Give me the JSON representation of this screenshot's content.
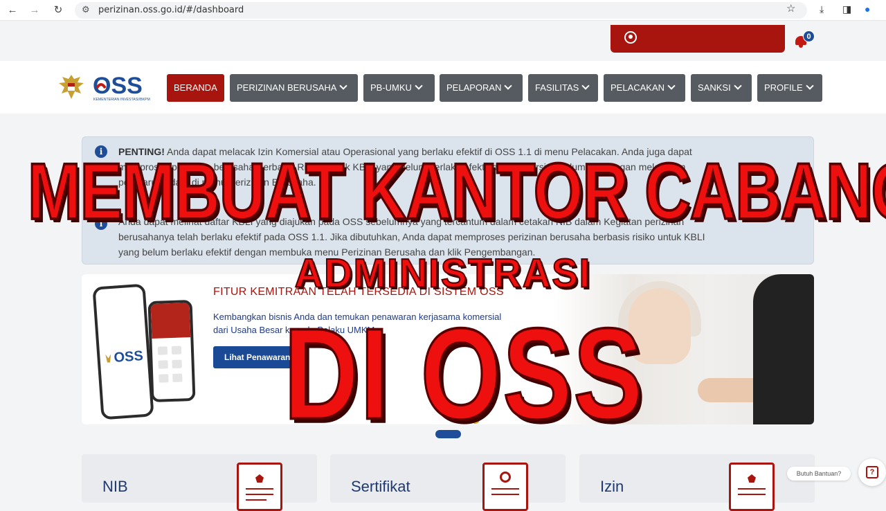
{
  "browser": {
    "url": "perizinan.oss.go.id/#/dashboard"
  },
  "notifications": {
    "count": "0"
  },
  "nav": {
    "items": [
      {
        "label": "BERANDA",
        "active": true
      },
      {
        "label": "PERIZINAN BERUSAHA"
      },
      {
        "label": "PB-UMKU"
      },
      {
        "label": "PELAPORAN"
      },
      {
        "label": "FASILITAS"
      },
      {
        "label": "PELACAKAN"
      },
      {
        "label": "SANKSI"
      },
      {
        "label": "PROFILE"
      }
    ]
  },
  "logo": {
    "text": "OSS",
    "subtext": "KEMENTERIAN INVESTASI/BKPM"
  },
  "info": {
    "notice1_strong": "PENTING!",
    "notice1_line1": " Anda dapat melacak Izin Komersial atau Operasional yang berlaku efektif di OSS 1.1 di menu Pelacakan. Anda juga dapat",
    "notice1_line2": "memproses perizinan berusaha Berbasis Risiko untuk KBLI yang belum berlaku efektif di OSS versi sebelumnya dengan melakukan",
    "notice1_line3": "pembaruan data di menu Perizinan Berusaha.",
    "notice2_line1": "Anda dapat melihat daftar KBLI yang diajukan pada OSS sebelumnya yang tercantum dalam cetakan NIB dalam Kegiatan perizinan",
    "notice2_line2": "berusahanya telah berlaku efektif pada OSS 1.1. Jika dibutuhkan, Anda dapat memproses perizinan berusaha berbasis risiko untuk KBLI",
    "notice2_line3": "yang belum berlaku efektif dengan membuka menu Perizinan Berusaha dan klik Pengembangan."
  },
  "banner": {
    "title": "FITUR KEMITRAAN TELAH TERSEDIA DI SISTEM OSS",
    "desc_line1": "Kembangkan bisnis Anda dan temukan penawaran kerjasama komersial",
    "desc_line2": "dari Usaha Besar kepada Pelaku UMKM",
    "button": "Lihat Penawaran"
  },
  "cards": [
    {
      "title": "NIB"
    },
    {
      "title": "Sertifikat"
    },
    {
      "title": "Izin"
    }
  ],
  "help": {
    "label": "Butuh Bantuan?"
  },
  "overlay": {
    "line1": "MEMBUAT KANTOR CABANG",
    "line2": "ADMINISTRASI",
    "line3": "DI OSS"
  },
  "colors": {
    "brand_red": "#a8150e",
    "brand_blue": "#1e4e9a",
    "menu_gray": "#555b60",
    "overlay_red": "#ee0f0f"
  }
}
